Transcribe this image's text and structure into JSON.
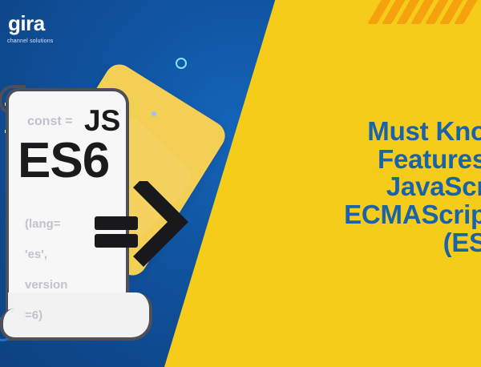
{
  "brand": {
    "name": "gira",
    "tagline": "channel solutions"
  },
  "card": {
    "code_prefix": "const =",
    "language": "JS",
    "version_label": "ES6",
    "code_lines": [
      "(lang=",
      "'es',",
      "version",
      "=6)"
    ]
  },
  "headline": {
    "lines": [
      "Must Kno",
      "Features",
      "JavaScr",
      "ECMAScrip",
      "(ES"
    ]
  },
  "colors": {
    "blue": "#0f4f9a",
    "yellow": "#f6cc1a",
    "headline": "#1b63a8",
    "scroll_outline": "#4e4f57"
  },
  "icons": {
    "arrow": "double-arrow-icon"
  }
}
